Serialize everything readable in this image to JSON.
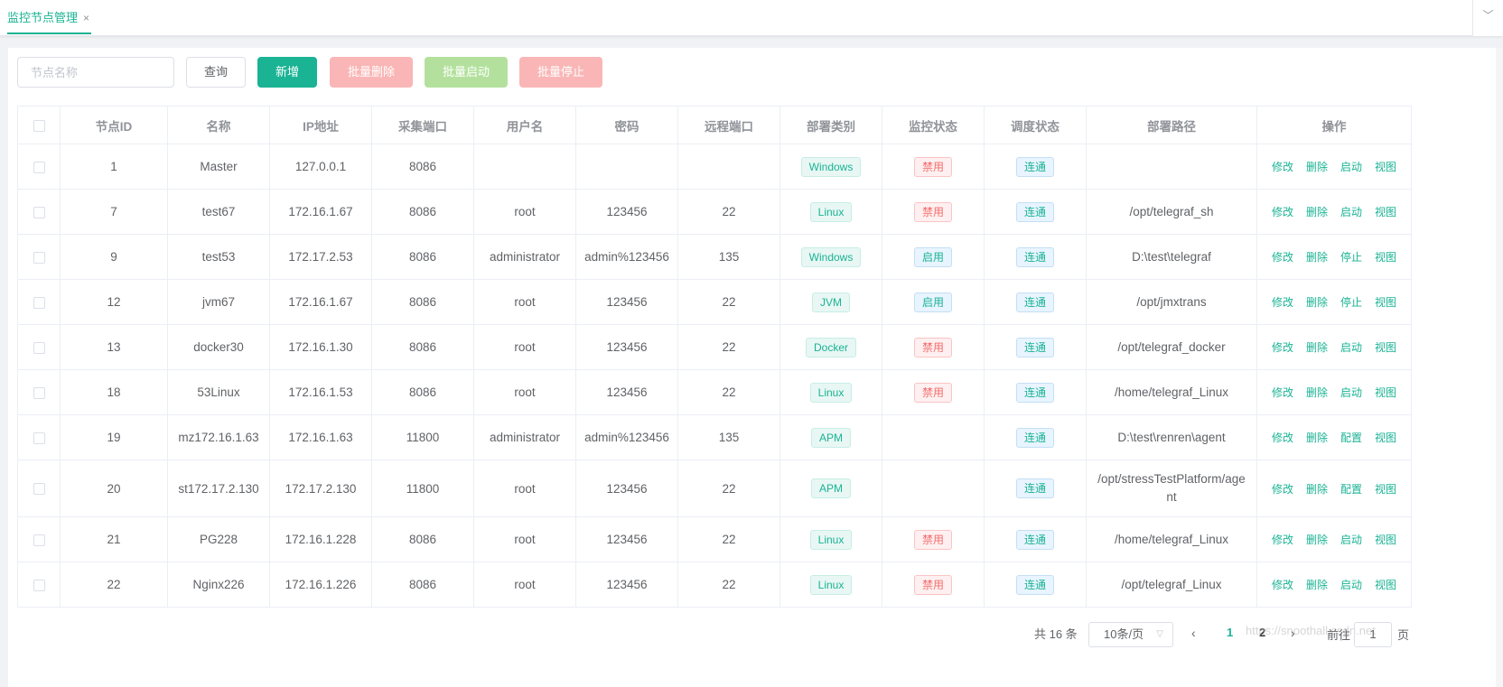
{
  "tabs": [
    {
      "label": "监控节点管理",
      "close": "×"
    }
  ],
  "tab_more_icon": "﹀",
  "toolbar": {
    "search_placeholder": "节点名称",
    "search_value": "",
    "query_label": "查询",
    "add_label": "新增",
    "batch_delete_label": "批量删除",
    "batch_start_label": "批量启动",
    "batch_stop_label": "批量停止"
  },
  "table": {
    "headers": [
      "节点ID",
      "名称",
      "IP地址",
      "采集端口",
      "用户名",
      "密码",
      "远程端口",
      "部署类别",
      "监控状态",
      "调度状态",
      "部署路径",
      "操作"
    ],
    "rows": [
      {
        "id": "1",
        "name": "Master",
        "ip": "127.0.0.1",
        "port": "8086",
        "user": "",
        "pwd": "",
        "rport": "",
        "type": "Windows",
        "monitor": "禁用",
        "sched": "连通",
        "path": "",
        "ops": [
          "修改",
          "删除",
          "启动",
          "视图"
        ]
      },
      {
        "id": "7",
        "name": "test67",
        "ip": "172.16.1.67",
        "port": "8086",
        "user": "root",
        "pwd": "123456",
        "rport": "22",
        "type": "Linux",
        "monitor": "禁用",
        "sched": "连通",
        "path": "/opt/telegraf_sh",
        "ops": [
          "修改",
          "删除",
          "启动",
          "视图"
        ]
      },
      {
        "id": "9",
        "name": "test53",
        "ip": "172.17.2.53",
        "port": "8086",
        "user": "administrator",
        "pwd": "admin%123456",
        "rport": "135",
        "type": "Windows",
        "monitor": "启用",
        "sched": "连通",
        "path": "D:\\test\\telegraf",
        "ops": [
          "修改",
          "删除",
          "停止",
          "视图"
        ]
      },
      {
        "id": "12",
        "name": "jvm67",
        "ip": "172.16.1.67",
        "port": "8086",
        "user": "root",
        "pwd": "123456",
        "rport": "22",
        "type": "JVM",
        "monitor": "启用",
        "sched": "连通",
        "path": "/opt/jmxtrans",
        "ops": [
          "修改",
          "删除",
          "停止",
          "视图"
        ]
      },
      {
        "id": "13",
        "name": "docker30",
        "ip": "172.16.1.30",
        "port": "8086",
        "user": "root",
        "pwd": "123456",
        "rport": "22",
        "type": "Docker",
        "monitor": "禁用",
        "sched": "连通",
        "path": "/opt/telegraf_docker",
        "ops": [
          "修改",
          "删除",
          "启动",
          "视图"
        ]
      },
      {
        "id": "18",
        "name": "53Linux",
        "ip": "172.16.1.53",
        "port": "8086",
        "user": "root",
        "pwd": "123456",
        "rport": "22",
        "type": "Linux",
        "monitor": "禁用",
        "sched": "连通",
        "path": "/home/telegraf_Linux",
        "ops": [
          "修改",
          "删除",
          "启动",
          "视图"
        ]
      },
      {
        "id": "19",
        "name": "mz172.16.1.63",
        "ip": "172.16.1.63",
        "port": "11800",
        "user": "administrator",
        "pwd": "admin%123456",
        "rport": "135",
        "type": "APM",
        "monitor": "",
        "sched": "连通",
        "path": "D:\\test\\renren\\agent",
        "ops": [
          "修改",
          "删除",
          "配置",
          "视图"
        ]
      },
      {
        "id": "20",
        "name": "st172.17.2.130",
        "ip": "172.17.2.130",
        "port": "11800",
        "user": "root",
        "pwd": "123456",
        "rport": "22",
        "type": "APM",
        "monitor": "",
        "sched": "连通",
        "path": "/opt/stressTestPlatform/agent",
        "ops": [
          "修改",
          "删除",
          "配置",
          "视图"
        ]
      },
      {
        "id": "21",
        "name": "PG228",
        "ip": "172.16.1.228",
        "port": "8086",
        "user": "root",
        "pwd": "123456",
        "rport": "22",
        "type": "Linux",
        "monitor": "禁用",
        "sched": "连通",
        "path": "/home/telegraf_Linux",
        "ops": [
          "修改",
          "删除",
          "启动",
          "视图"
        ]
      },
      {
        "id": "22",
        "name": "Nginx226",
        "ip": "172.16.1.226",
        "port": "8086",
        "user": "root",
        "pwd": "123456",
        "rport": "22",
        "type": "Linux",
        "monitor": "禁用",
        "sched": "连通",
        "path": "/opt/telegraf_Linux",
        "ops": [
          "修改",
          "删除",
          "启动",
          "视图"
        ]
      }
    ]
  },
  "pagination": {
    "total_text": "共 16 条",
    "page_size": "10条/页",
    "prev_icon": "‹",
    "next_icon": "›",
    "pages": [
      "1",
      "2"
    ],
    "current_page": "1",
    "jump_label": "前往",
    "jump_value": "1",
    "jump_unit": "页"
  },
  "watermark": "https://snoothall.csdn.net",
  "colors": {
    "accent": "#1ab394",
    "danger": "#f56c6c"
  }
}
